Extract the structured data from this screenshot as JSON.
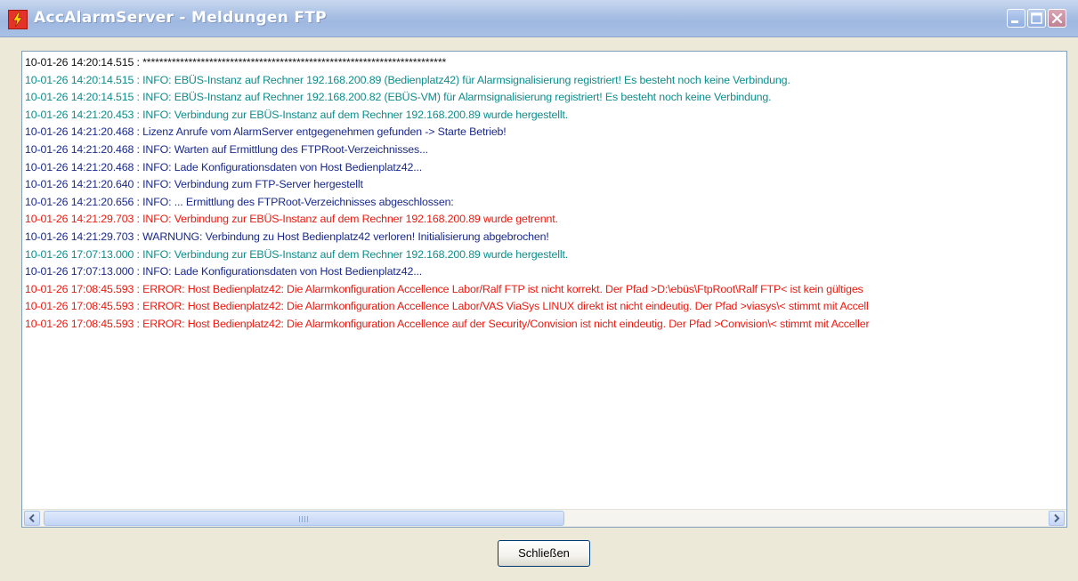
{
  "window": {
    "title": "AccAlarmServer - Meldungen FTP",
    "icon": "lightning-app-icon"
  },
  "titlebar_buttons": {
    "minimize_icon": "minimize-icon",
    "maximize_icon": "maximize-icon",
    "close_icon": "close-icon"
  },
  "log": {
    "lines": [
      {
        "text": "10-01-26 14:20:14.515 : *************************************************************************",
        "color": "#111111"
      },
      {
        "text": "10-01-26 14:20:14.515 : INFO: EBÜS-Instanz auf Rechner 192.168.200.89 (Bedienplatz42) für Alarmsignalisierung registriert! Es besteht noch keine Verbindung.",
        "color": "#0f8c8c"
      },
      {
        "text": "10-01-26 14:20:14.515 : INFO: EBÜS-Instanz auf Rechner 192.168.200.82 (EBÜS-VM) für Alarmsignalisierung registriert! Es besteht noch keine Verbindung.",
        "color": "#0f8c8c"
      },
      {
        "text": "10-01-26 14:21:20.453 : INFO: Verbindung zur EBÜS-Instanz auf dem Rechner 192.168.200.89 wurde hergestellt.",
        "color": "#0f8c8c"
      },
      {
        "text": "10-01-26 14:21:20.468 : Lizenz Anrufe vom AlarmServer entgegenehmen gefunden -> Starte Betrieb!",
        "color": "#1a2a8a"
      },
      {
        "text": "10-01-26 14:21:20.468 : INFO: Warten auf Ermittlung des FTPRoot-Verzeichnisses...",
        "color": "#1a2a8a"
      },
      {
        "text": "10-01-26 14:21:20.468 : INFO: Lade Konfigurationsdaten von Host Bedienplatz42...",
        "color": "#1a2a8a"
      },
      {
        "text": "10-01-26 14:21:20.640 : INFO: Verbindung zum FTP-Server hergestellt",
        "color": "#1a2a8a"
      },
      {
        "text": "10-01-26 14:21:20.656 : INFO: ... Ermittlung des FTPRoot-Verzeichnisses abgeschlossen:",
        "color": "#1a2a8a"
      },
      {
        "text": "10-01-26 14:21:29.703 : INFO: Verbindung zur EBÜS-Instanz auf dem Rechner 192.168.200.89 wurde getrennt.",
        "color": "#e81a10"
      },
      {
        "text": "10-01-26 14:21:29.703 : WARNUNG: Verbindung zu Host Bedienplatz42 verloren! Initialisierung abgebrochen!",
        "color": "#1a2a8a"
      },
      {
        "text": "10-01-26 17:07:13.000 : INFO: Verbindung zur EBÜS-Instanz auf dem Rechner 192.168.200.89 wurde hergestellt.",
        "color": "#0f8c8c"
      },
      {
        "text": "10-01-26 17:07:13.000 : INFO: Lade Konfigurationsdaten von Host Bedienplatz42...",
        "color": "#1a2a8a"
      },
      {
        "text": "10-01-26 17:08:45.593 : ERROR: Host Bedienplatz42: Die Alarmkonfiguration Accellence Labor/Ralf FTP ist nicht korrekt. Der Pfad >D:\\ebüs\\FtpRoot\\Ralf FTP< ist kein gültiges",
        "color": "#e81a10"
      },
      {
        "text": "10-01-26 17:08:45.593 : ERROR: Host Bedienplatz42: Die Alarmkonfiguration Accellence Labor/VAS ViaSys LINUX direkt ist nicht eindeutig. Der Pfad >viasys\\< stimmt mit Accell",
        "color": "#e81a10"
      },
      {
        "text": "10-01-26 17:08:45.593 : ERROR: Host Bedienplatz42: Die Alarmkonfiguration Accellence auf der Security/Convision ist nicht eindeutig. Der Pfad >Convision\\< stimmt mit Acceller",
        "color": "#e81a10"
      }
    ]
  },
  "scrollbar": {
    "left_icon": "scroll-left-arrow-icon",
    "right_icon": "scroll-right-arrow-icon",
    "position_fraction": 0
  },
  "footer": {
    "close_label": "Schließen"
  }
}
